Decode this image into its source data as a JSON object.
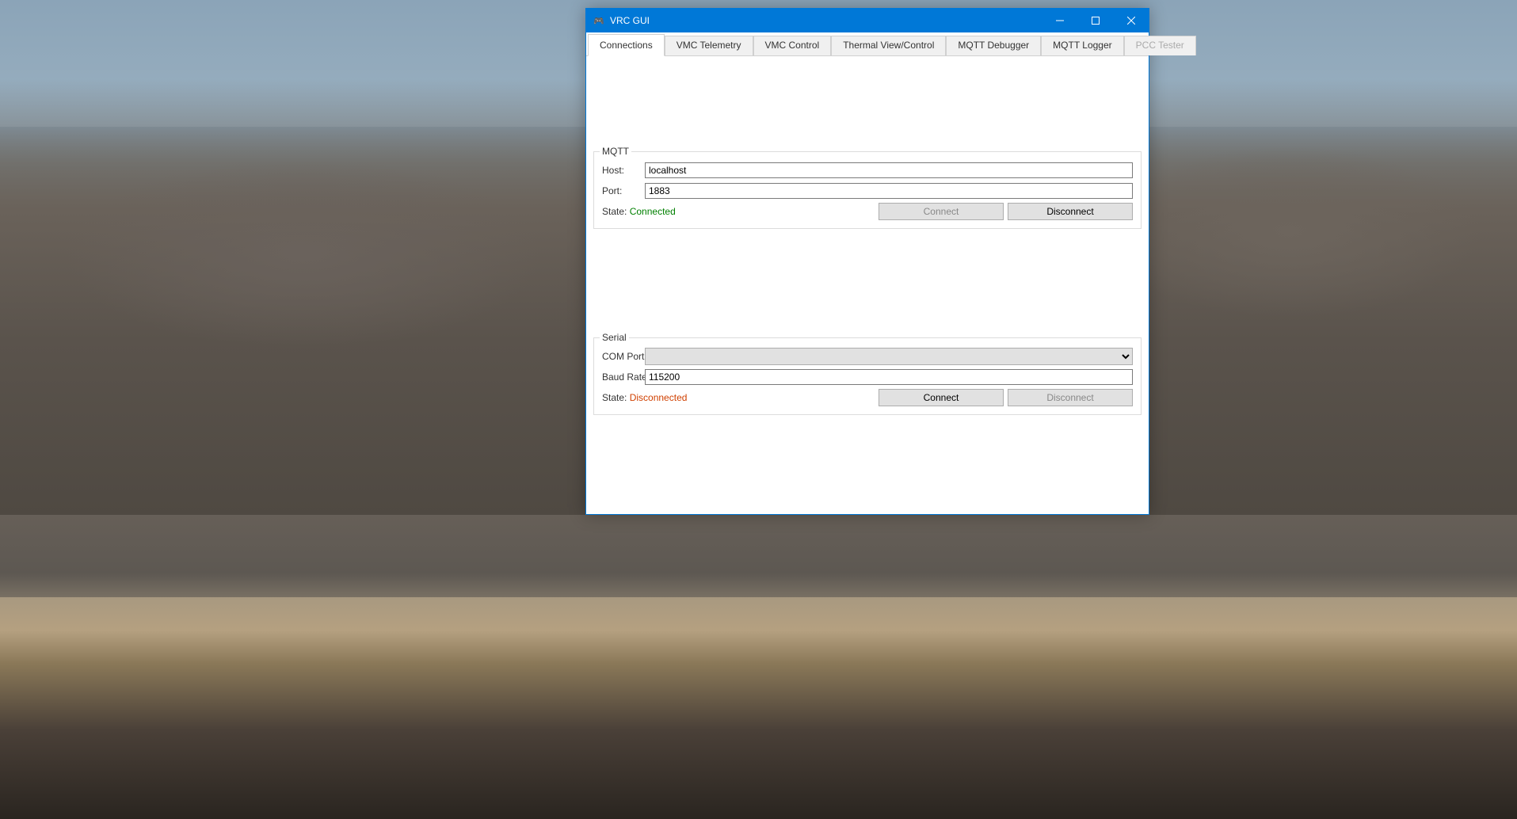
{
  "window": {
    "title": "VRC GUI",
    "icon": "🎮"
  },
  "tabs": [
    {
      "label": "Connections",
      "active": true,
      "disabled": false
    },
    {
      "label": "VMC Telemetry",
      "active": false,
      "disabled": false
    },
    {
      "label": "VMC Control",
      "active": false,
      "disabled": false
    },
    {
      "label": "Thermal View/Control",
      "active": false,
      "disabled": false
    },
    {
      "label": "MQTT Debugger",
      "active": false,
      "disabled": false
    },
    {
      "label": "MQTT Logger",
      "active": false,
      "disabled": false
    },
    {
      "label": "PCC Tester",
      "active": false,
      "disabled": true
    }
  ],
  "mqtt": {
    "group_title": "MQTT",
    "host_label": "Host:",
    "host_value": "localhost",
    "port_label": "Port:",
    "port_value": "1883",
    "state_label": "State:",
    "state_value": "Connected",
    "connect_label": "Connect",
    "disconnect_label": "Disconnect"
  },
  "serial": {
    "group_title": "Serial",
    "comport_label": "COM Port:",
    "comport_value": "",
    "baud_label": "Baud Rate:",
    "baud_value": "115200",
    "state_label": "State:",
    "state_value": "Disconnected",
    "connect_label": "Connect",
    "disconnect_label": "Disconnect"
  }
}
